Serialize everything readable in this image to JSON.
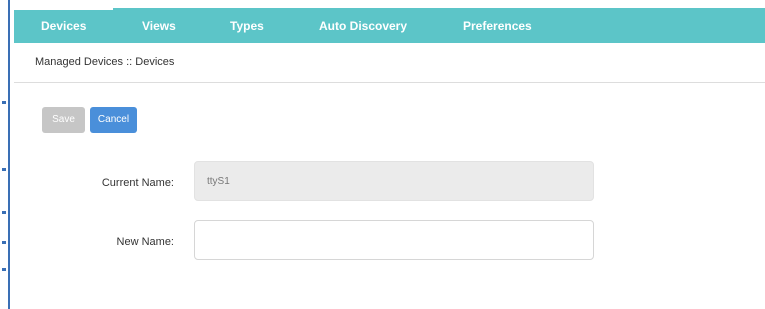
{
  "nav": {
    "items": [
      {
        "label": "Devices",
        "active": true
      },
      {
        "label": "Views",
        "active": false
      },
      {
        "label": "Types",
        "active": false
      },
      {
        "label": "Auto Discovery",
        "active": false
      },
      {
        "label": "Preferences",
        "active": false
      }
    ],
    "bar_color": "#5cc5c8"
  },
  "breadcrumb": "Managed Devices :: Devices",
  "toolbar": {
    "save_label": "Save",
    "cancel_label": "Cancel",
    "save_color": "#c6c6c6",
    "cancel_color": "#4a8fda"
  },
  "form": {
    "current_name_label": "Current Name:",
    "current_name_value": "ttyS1",
    "new_name_label": "New Name:",
    "new_name_value": ""
  }
}
